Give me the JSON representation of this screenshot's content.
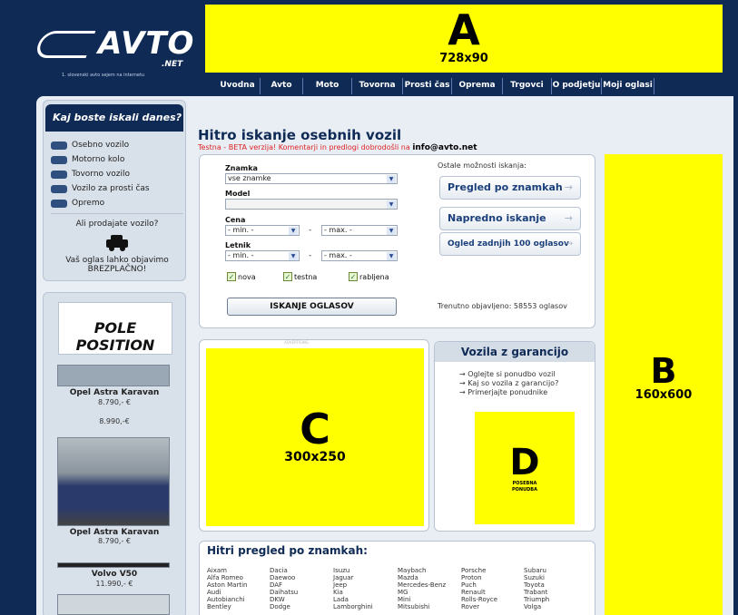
{
  "header": {
    "logo_word": "AVTO",
    "logo_net": ".NET",
    "logo_tagline": "1. slovenski avto sejem na internetu",
    "banner_a": {
      "letter": "A",
      "size": "728x90"
    }
  },
  "nav": {
    "items": [
      "Uvodna",
      "Avto",
      "Moto",
      "Tovorna",
      "Prosti čas",
      "Oprema",
      "Trgovci",
      "O podjetju",
      "Moji oglasi"
    ]
  },
  "sidebar": {
    "title": "Kaj boste iskali danes?",
    "items": [
      "Osebno vozilo",
      "Motorno kolo",
      "Tovorno vozilo",
      "Vozilo za prosti čas",
      "Opremo"
    ],
    "sell_question": "Ali prodajate vozilo?",
    "sell_text": "Vaš oglas lahko objavimo",
    "sell_free": "BREZPLAČNO!"
  },
  "sidebar_ads": {
    "logo_text": "POLE POSITION",
    "cars": [
      {
        "title": "Opel Astra Karavan",
        "price": "8.790,- €"
      },
      {
        "title": "",
        "price": "8.990,-€"
      },
      {
        "title": "Opel Astra Karavan",
        "price": "8.790,- €"
      },
      {
        "title": "Volvo V50",
        "price": "11.990,- €"
      }
    ]
  },
  "search": {
    "title": "Hitro iskanje osebnih vozil",
    "beta_text": "Testna - BETA verzija! Komentarji in predlogi dobrodošli na",
    "beta_email": "info@avto.net",
    "labels": {
      "brand": "Znamka",
      "model": "Model",
      "price": "Cena",
      "year": "Letnik"
    },
    "brand_value": "vse znamke",
    "model_value": "",
    "price_min": "- min. -",
    "price_max": "- max. -",
    "year_min": "- min. -",
    "year_max": "- max. -",
    "dash": "-",
    "checkboxes": [
      "nova",
      "testna",
      "rabljena"
    ],
    "check_mark": "✓",
    "submit": "ISKANJE OGLASOV",
    "other_label": "Ostale možnosti iskanja:",
    "other_buttons": [
      "Pregled po znamkah",
      "Napredno iskanje",
      "Ogled zadnjih 100 oglasov"
    ],
    "arrow": "→",
    "count_text": "Trenutno objavljeno: 58553 oglasov"
  },
  "banner_c": {
    "letter": "C",
    "size": "300x250",
    "label": "ADVERTISING"
  },
  "guarantee": {
    "title": "Vozila z garancijo",
    "links": [
      "Oglejte si ponudbo vozil",
      "Kaj so vozila z garancijo?",
      "Primerjajte ponudnike"
    ],
    "banner_d": {
      "letter": "D",
      "line1": "POSEBNA",
      "line2": "PONUDBA"
    }
  },
  "banner_b": {
    "letter": "B",
    "size": "160x600"
  },
  "brands": {
    "title": "Hitri pregled po znamkah:",
    "columns": [
      [
        "Aixam",
        "Alfa Romeo",
        "Aston Martin",
        "Audi",
        "Autobianchi",
        "Bentley"
      ],
      [
        "Dacia",
        "Daewoo",
        "DAF",
        "Daihatsu",
        "DKW",
        "Dodge"
      ],
      [
        "Isuzu",
        "Jaguar",
        "Jeep",
        "Kia",
        "Lada",
        "Lamborghini"
      ],
      [
        "Maybach",
        "Mazda",
        "Mercedes-Benz",
        "MG",
        "Mini",
        "Mitsubishi"
      ],
      [
        "Porsche",
        "Proton",
        "Puch",
        "Renault",
        "Rolls-Royce",
        "Rover"
      ],
      [
        "Subaru",
        "Suzuki",
        "Toyota",
        "Trabant",
        "Triumph",
        "Volga"
      ]
    ]
  }
}
